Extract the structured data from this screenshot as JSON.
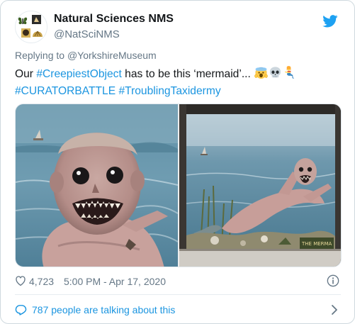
{
  "author": {
    "name": "Natural Sciences NMS",
    "handle": "@NatSciNMS"
  },
  "reply": {
    "prefix": "Replying to ",
    "to": "@YorkshireMuseum"
  },
  "tweet": {
    "part1": "Our ",
    "hashtag1": "#CreepiestObject",
    "part2": " has to be this ‘mermaid’... ",
    "emojis": [
      "scream-face-emoji",
      "skull-emoji",
      "mermaid-emoji"
    ],
    "hashtag2": "#CURATORBATTLE",
    "hashtag3": "#TroublingTaxidermy"
  },
  "media": {
    "photos": [
      "mermaid-closeup-photo",
      "mermaid-display-case-photo"
    ],
    "case_label": "THE MERMA"
  },
  "meta": {
    "likes": "4,723",
    "timestamp": "5:00 PM - Apr 17, 2020"
  },
  "talking": {
    "label": "787 people are talking about this"
  },
  "colors": {
    "link": "#1b95e0",
    "secondary_text": "#657786",
    "primary_text": "#14171a",
    "border": "#e6ecf0"
  },
  "icons": [
    "twitter-bird-icon",
    "heart-icon",
    "info-icon",
    "speech-bubble-icon",
    "chevron-right-icon"
  ]
}
